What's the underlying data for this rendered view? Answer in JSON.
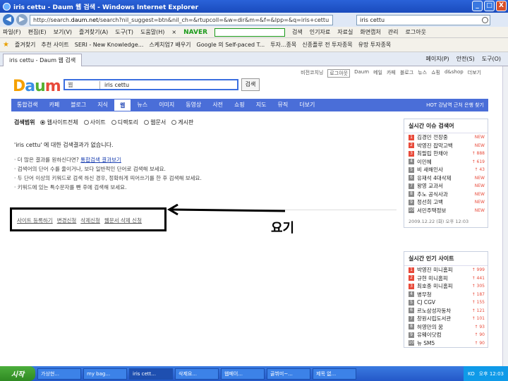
{
  "window": {
    "title": "iris cettu - Daum 웹 검색 - Windows Internet Explorer",
    "min": "_",
    "max": "□",
    "close": "X"
  },
  "address": {
    "url_prefix": "http://search.",
    "url_domain": "daum.net",
    "url_rest": "/search?nil_suggest=btn&nil_ch=&rtupcoll=&w=dir&m=&f=&lpp=&q=iris+cettu",
    "search_value": "iris cettu"
  },
  "menu": {
    "items": [
      "파일(F)",
      "편집(E)",
      "보기(V)",
      "즐겨찾기(A)",
      "도구(T)",
      "도움말(H)"
    ],
    "close_x": "×",
    "naver": "NAVER",
    "search": "검색",
    "tools": [
      "인기자료",
      "자료실",
      "화면캡처"
    ],
    "manage": "관리",
    "login": "로그아웃"
  },
  "favorites": {
    "label": "즐겨찾기",
    "items": [
      "추천 사이트",
      "SERI - New Knowledge...",
      "스케치업7 배우기",
      "Google 의 Self-paced T...",
      "투자...종목",
      "신종플루 전 투자종목",
      "유망 투자종목"
    ]
  },
  "tabbar": {
    "tab": "iris cettu - Daum 웹 검색",
    "tools": [
      "페이지(P)",
      "안전(S)",
      "도구(O)"
    ]
  },
  "daum": {
    "toplinks": [
      "비전코치닝",
      "로그아웃",
      "Daum",
      "메일",
      "카페",
      "블로그",
      "뉴스",
      "쇼핑",
      "d&shop",
      "더보기"
    ],
    "logo": [
      "D",
      "a",
      "u",
      "m"
    ],
    "scope_select": "웹",
    "query": "iris cettu",
    "search_btn": "검색",
    "categories": [
      "통합검색",
      "카페",
      "블로그",
      "지식",
      "웹",
      "뉴스",
      "이미지",
      "동영상",
      "사전",
      "쇼핑",
      "지도",
      "뮤직",
      "더보기"
    ],
    "active_category": "웹",
    "cat_right": "HOT 강남역 근처 은행 찾기",
    "scope_label": "검색범위",
    "scope_options": [
      "웹사이트전체",
      "사이트",
      "디렉토리",
      "웹문서",
      "게시판"
    ],
    "noresult": "'iris cettu' 에 대한 검색결과가 없습니다.",
    "tips": {
      "t1": "· 더 많은 결과를 원하신다면?",
      "t1_link": "통합검색 결과보기",
      "t2": "· 검색어의 단어 수를 줄이거나, 보다 일반적인 단어로 검색해 보세요.",
      "t3": "· 두 단어 이상의 키워드로 검색 하신 경우, 정확하게 띄어쓰기를 한 후 검색해 보세요.",
      "t4": "· 키워드에 있는 특수문자를 뺀 후에 검색해 보세요."
    },
    "bottom_links": [
      "사이트 등록하기",
      "변경신청",
      "삭제신청",
      "웹문서 삭제 신청"
    ],
    "annotation": "요기"
  },
  "trend": {
    "title": "실시간 이슈 검색어",
    "items": [
      {
        "t": "김경민 전장중",
        "b": "NEW"
      },
      {
        "t": "박영진 잡막고백",
        "b": "NEW"
      },
      {
        "t": "최필립 한채아",
        "b": "↑ 888"
      },
      {
        "t": "이민혜",
        "b": "↑ 619"
      },
      {
        "t": "비 새해인사",
        "b": "↑ 43"
      },
      {
        "t": "유재석 4대삭제",
        "b": "NEW"
      },
      {
        "t": "왕영 교과서",
        "b": "NEW"
      },
      {
        "t": "추노 공식사과",
        "b": "NEW"
      },
      {
        "t": "정선희 고백",
        "b": "NEW"
      },
      {
        "t": "서민주택정보",
        "b": "NEW"
      }
    ],
    "foot": "2009.12.22 (화) 오후 12:03"
  },
  "popular": {
    "title": "실시간 인기 사이트",
    "items": [
      {
        "t": "박영진 미니홈피",
        "b": "↑ 999"
      },
      {
        "t": "규현 미니홈피",
        "b": "↑ 441"
      },
      {
        "t": "최호종 미니홈피",
        "b": "↑ 305"
      },
      {
        "t": "병무청",
        "b": "↑ 187"
      },
      {
        "t": "CJ CGV",
        "b": "↑ 155"
      },
      {
        "t": "르노삼성자동차",
        "b": "↑ 121"
      },
      {
        "t": "창원시립도서관",
        "b": "↑ 101"
      },
      {
        "t": "허영만의 꿈",
        "b": "↑ 93"
      },
      {
        "t": "유웨이닷컴",
        "b": "↑ 90"
      },
      {
        "t": "뉴 SM5",
        "b": "↑ 90"
      }
    ]
  },
  "taskbar": {
    "start": "시작",
    "tasks": [
      "가상현...",
      "my bag...",
      "iris cett...",
      "삭제요...",
      "웹페이...",
      "골뷔미~...",
      "제목 없..."
    ],
    "active_task": "iris cett...",
    "lang": "KO",
    "clock": "오후 12:03"
  }
}
